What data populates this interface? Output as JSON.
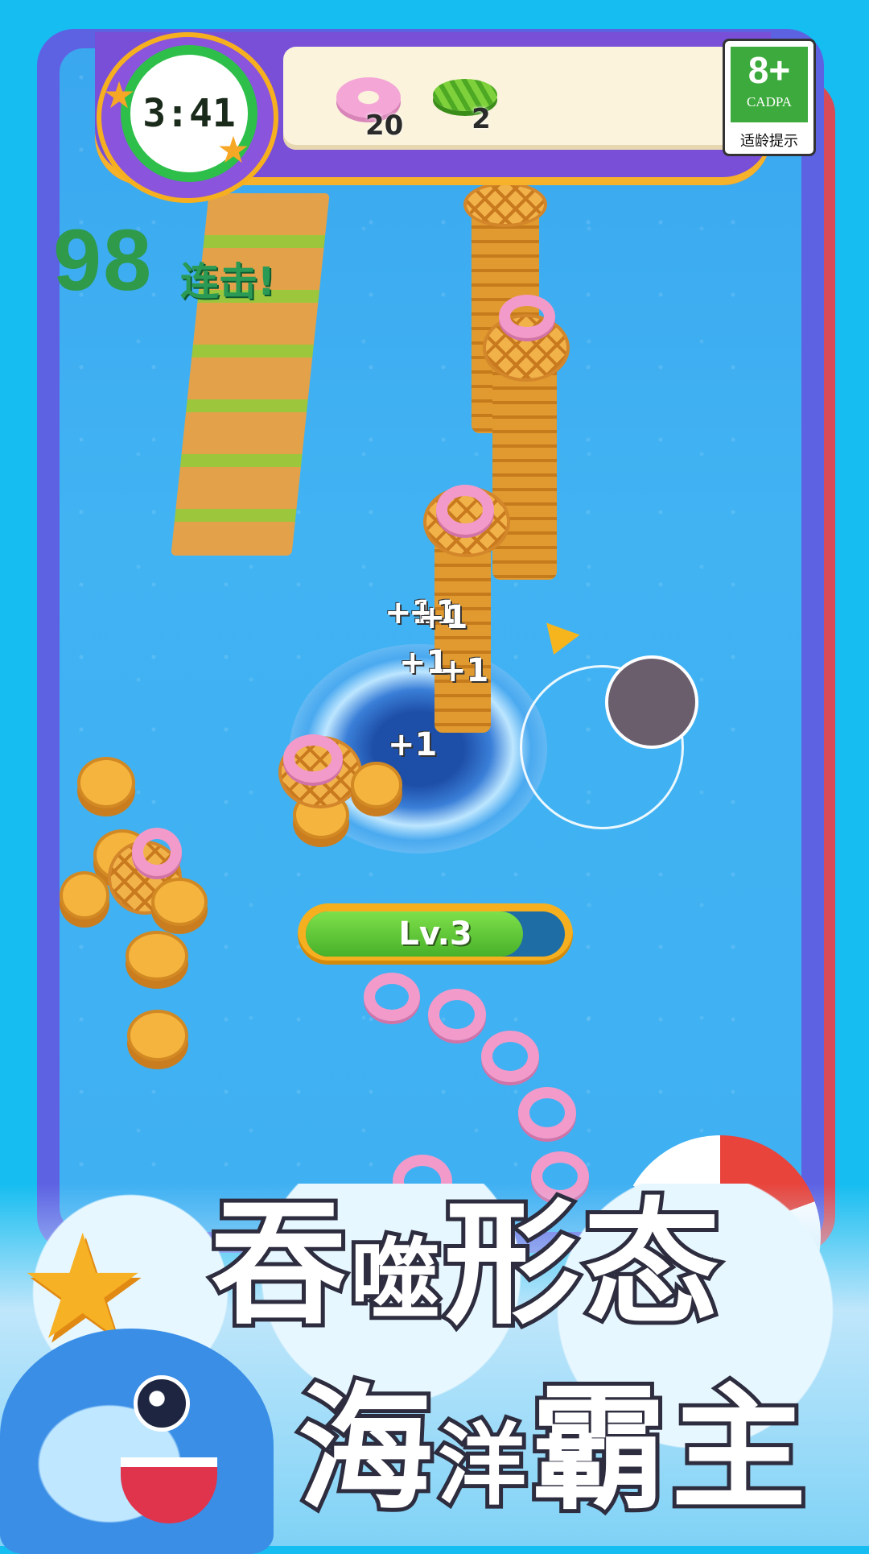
{
  "hud": {
    "timer": "3:41",
    "counters": [
      {
        "icon": "pink-donut-icon",
        "value": "20"
      },
      {
        "icon": "lettuce-icon",
        "value": "2"
      }
    ],
    "age_rating": {
      "label": "8+",
      "org": "CADPA",
      "tip": "适龄提示"
    }
  },
  "score": {
    "value": "98",
    "combo_label": "连击!"
  },
  "floating_points": [
    "+1",
    "+1",
    "+1",
    "+1",
    "+1",
    "+1"
  ],
  "player": {
    "level_label": "Lv.3",
    "level_progress": 0.84
  },
  "promo": {
    "line1_a": "吞",
    "line1_b": "噬",
    "line1_c": "形态",
    "line2_a": "海",
    "line2_b": "洋",
    "line2_c": "霸主"
  },
  "colors": {
    "frame": "#5d62e3",
    "water": "#3fb0f2",
    "timer_ring": "#2dbf4a",
    "level_fill": "#48b12a",
    "accent": "#f6b01f"
  }
}
